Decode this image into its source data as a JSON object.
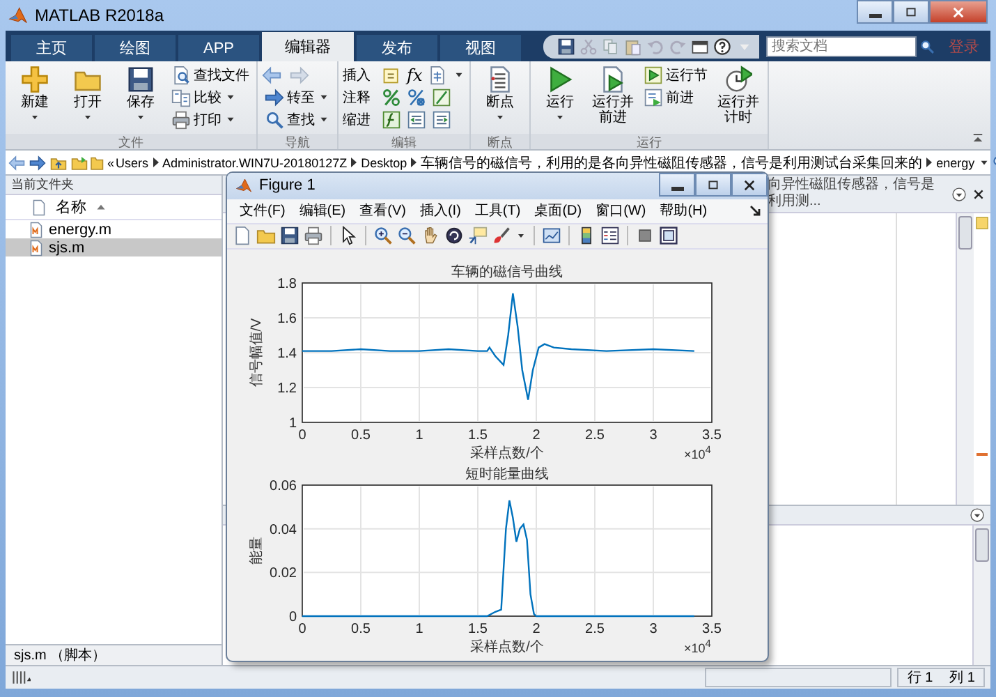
{
  "window": {
    "title": "MATLAB R2018a"
  },
  "tabs": [
    {
      "label": "主页",
      "selected": false
    },
    {
      "label": "绘图",
      "selected": false
    },
    {
      "label": "APP",
      "selected": false
    },
    {
      "label": "编辑器",
      "selected": true
    },
    {
      "label": "发布",
      "selected": false
    },
    {
      "label": "视图",
      "selected": false
    }
  ],
  "search": {
    "placeholder": "搜索文档"
  },
  "login": "登录",
  "ribbon": {
    "groups": [
      {
        "label": "文件",
        "buttons": [
          {
            "label": "新建",
            "kind": "large",
            "dropdown": true
          },
          {
            "label": "打开",
            "kind": "large",
            "dropdown": true
          },
          {
            "label": "保存",
            "kind": "large",
            "dropdown": true
          },
          {
            "label": "查找文件",
            "kind": "small",
            "dropdown": false
          },
          {
            "label": "比较",
            "kind": "small",
            "dropdown": true
          },
          {
            "label": "打印",
            "kind": "small",
            "dropdown": true
          }
        ]
      },
      {
        "label": "导航",
        "buttons": [
          {
            "label": "转至",
            "kind": "small",
            "dropdown": true
          },
          {
            "label": "查找",
            "kind": "small",
            "dropdown": true
          }
        ]
      },
      {
        "label": "编辑",
        "buttons": [
          {
            "label": "插入",
            "kind": "row",
            "dropdown": true,
            "symbol": "fx"
          },
          {
            "label": "注释",
            "kind": "row",
            "dropdown": false
          },
          {
            "label": "缩进",
            "kind": "row",
            "dropdown": false
          }
        ]
      },
      {
        "label": "断点",
        "buttons": [
          {
            "label": "断点",
            "kind": "large",
            "dropdown": true
          }
        ]
      },
      {
        "label": "运行",
        "buttons": [
          {
            "label": "运行",
            "kind": "large",
            "dropdown": true
          },
          {
            "label": "运行并前进",
            "kind": "large",
            "dropdown": false
          },
          {
            "label": "运行节",
            "kind": "small",
            "dropdown": false
          },
          {
            "label": "前进",
            "kind": "small",
            "dropdown": false
          },
          {
            "label": "运行并计时",
            "kind": "large",
            "dropdown": false
          }
        ]
      }
    ]
  },
  "address_bar": {
    "overflow": "«",
    "path": [
      "Users",
      "Administrator.WIN7U-20180127Z",
      "Desktop",
      "车辆信号的磁信号，利用的是各向异性磁阻传感器，信号是利用测试台采集回来的",
      "energy"
    ]
  },
  "current_folder": {
    "title": "当前文件夹",
    "column": "名称",
    "files": [
      {
        "name": "energy.m",
        "selected": false
      },
      {
        "name": "sjs.m",
        "selected": true
      }
    ],
    "details": "sjs.m （脚本）"
  },
  "editor": {
    "title": "向异性磁阻传感器，信号是利用测..."
  },
  "figure": {
    "title": "Figure 1",
    "menu": [
      "文件(F)",
      "编辑(E)",
      "查看(V)",
      "插入(I)",
      "工具(T)",
      "桌面(D)",
      "窗口(W)",
      "帮助(H)"
    ],
    "charts": [
      {
        "chart_data": {
          "type": "line",
          "title": "车辆的磁信号曲线",
          "xlabel": "采样点数/个",
          "ylabel": "信号幅值/V",
          "x": [
            0,
            0.25,
            0.5,
            0.75,
            1,
            1.25,
            1.5,
            1.58,
            1.6,
            1.65,
            1.72,
            1.76,
            1.8,
            1.84,
            1.88,
            1.93,
            1.97,
            2.02,
            2.07,
            2.15,
            2.3,
            2.6,
            3,
            3.35
          ],
          "grid": true,
          "series": [
            {
              "color": "#0072bd",
              "values": [
                1.41,
                1.41,
                1.42,
                1.41,
                1.41,
                1.42,
                1.41,
                1.41,
                1.43,
                1.38,
                1.33,
                1.5,
                1.74,
                1.55,
                1.3,
                1.13,
                1.3,
                1.43,
                1.45,
                1.43,
                1.42,
                1.41,
                1.42,
                1.41
              ]
            }
          ],
          "xlim": [
            0,
            3.5
          ],
          "ylim": [
            1,
            1.8
          ],
          "xticks": [
            0,
            0.5,
            1,
            1.5,
            2,
            2.5,
            3,
            3.5
          ],
          "yticks": [
            1,
            1.2,
            1.4,
            1.6,
            1.8
          ],
          "annotations": [
            {
              "text": "×10$^{4}$"
            }
          ]
        }
      },
      {
        "chart_data": {
          "type": "line",
          "title": "短时能量曲线",
          "xlabel": "采样点数/个",
          "ylabel": "能量",
          "x": [
            0,
            0.5,
            1,
            1.5,
            1.58,
            1.65,
            1.7,
            1.74,
            1.77,
            1.8,
            1.83,
            1.86,
            1.89,
            1.92,
            1.95,
            1.98,
            2,
            2.5,
            3,
            3.35
          ],
          "grid": true,
          "series": [
            {
              "color": "#0072bd",
              "values": [
                0,
                0,
                0,
                0,
                0,
                0.002,
                0.003,
                0.04,
                0.053,
                0.045,
                0.034,
                0.04,
                0.042,
                0.035,
                0.01,
                0.001,
                0,
                0,
                0,
                0
              ]
            }
          ],
          "xlim": [
            0,
            3.5
          ],
          "ylim": [
            0,
            0.06
          ],
          "xticks": [
            0,
            0.5,
            1,
            1.5,
            2,
            2.5,
            3,
            3.5
          ],
          "yticks": [
            0,
            0.02,
            0.04,
            0.06
          ],
          "annotations": [
            {
              "text": "×10$^{4}$"
            }
          ]
        }
      }
    ]
  },
  "status_bar": {
    "line": "行 1",
    "column": "列 1"
  }
}
